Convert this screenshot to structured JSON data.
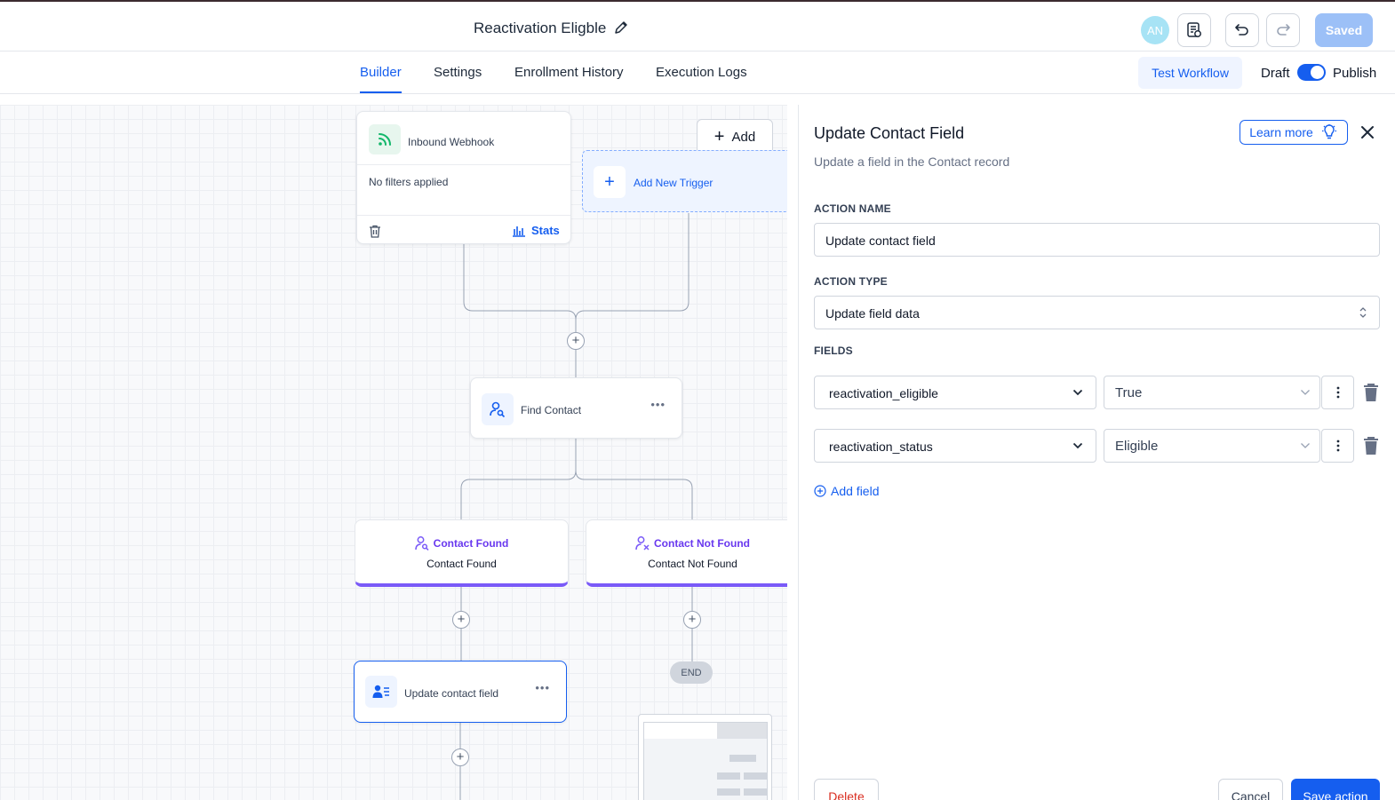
{
  "header": {
    "workflow_title": "Reactivation Eligble",
    "avatar_initials": "AN",
    "saved_label": "Saved"
  },
  "tabs": {
    "builder": "Builder",
    "settings": "Settings",
    "enrollment_history": "Enrollment History",
    "execution_logs": "Execution Logs",
    "active": "Builder"
  },
  "toolbar": {
    "test_workflow": "Test Workflow",
    "draft": "Draft",
    "publish": "Publish",
    "published": true
  },
  "canvas": {
    "trigger": {
      "name": "Inbound Webhook",
      "filters": "No filters applied",
      "stats": "Stats"
    },
    "add_button": "Add",
    "add_new_trigger": "Add New Trigger",
    "find_contact": "Find Contact",
    "branches": [
      {
        "title": "Contact Found",
        "subtitle": "Contact Found"
      },
      {
        "title": "Contact Not Found",
        "subtitle": "Contact Not Found"
      }
    ],
    "update_node": "Update contact field",
    "end": "END"
  },
  "panel": {
    "title": "Update Contact Field",
    "subtitle": "Update a field in the Contact record",
    "learn_more": "Learn more",
    "action_name_label": "ACTION NAME",
    "action_name_value": "Update contact field",
    "action_type_label": "ACTION TYPE",
    "action_type_value": "Update field data",
    "fields_label": "FIELDS",
    "fields": [
      {
        "field": "reactivation_eligible",
        "value": "True"
      },
      {
        "field": "reactivation_status",
        "value": "Eligible"
      }
    ],
    "add_field": "Add field",
    "delete": "Delete",
    "cancel": "Cancel",
    "save": "Save action"
  },
  "colors": {
    "accent": "#155eef",
    "branch_purple": "#7a5af8",
    "saved_button": "#9cc0f7",
    "trigger_icon_bg": "#e7f6ee"
  }
}
